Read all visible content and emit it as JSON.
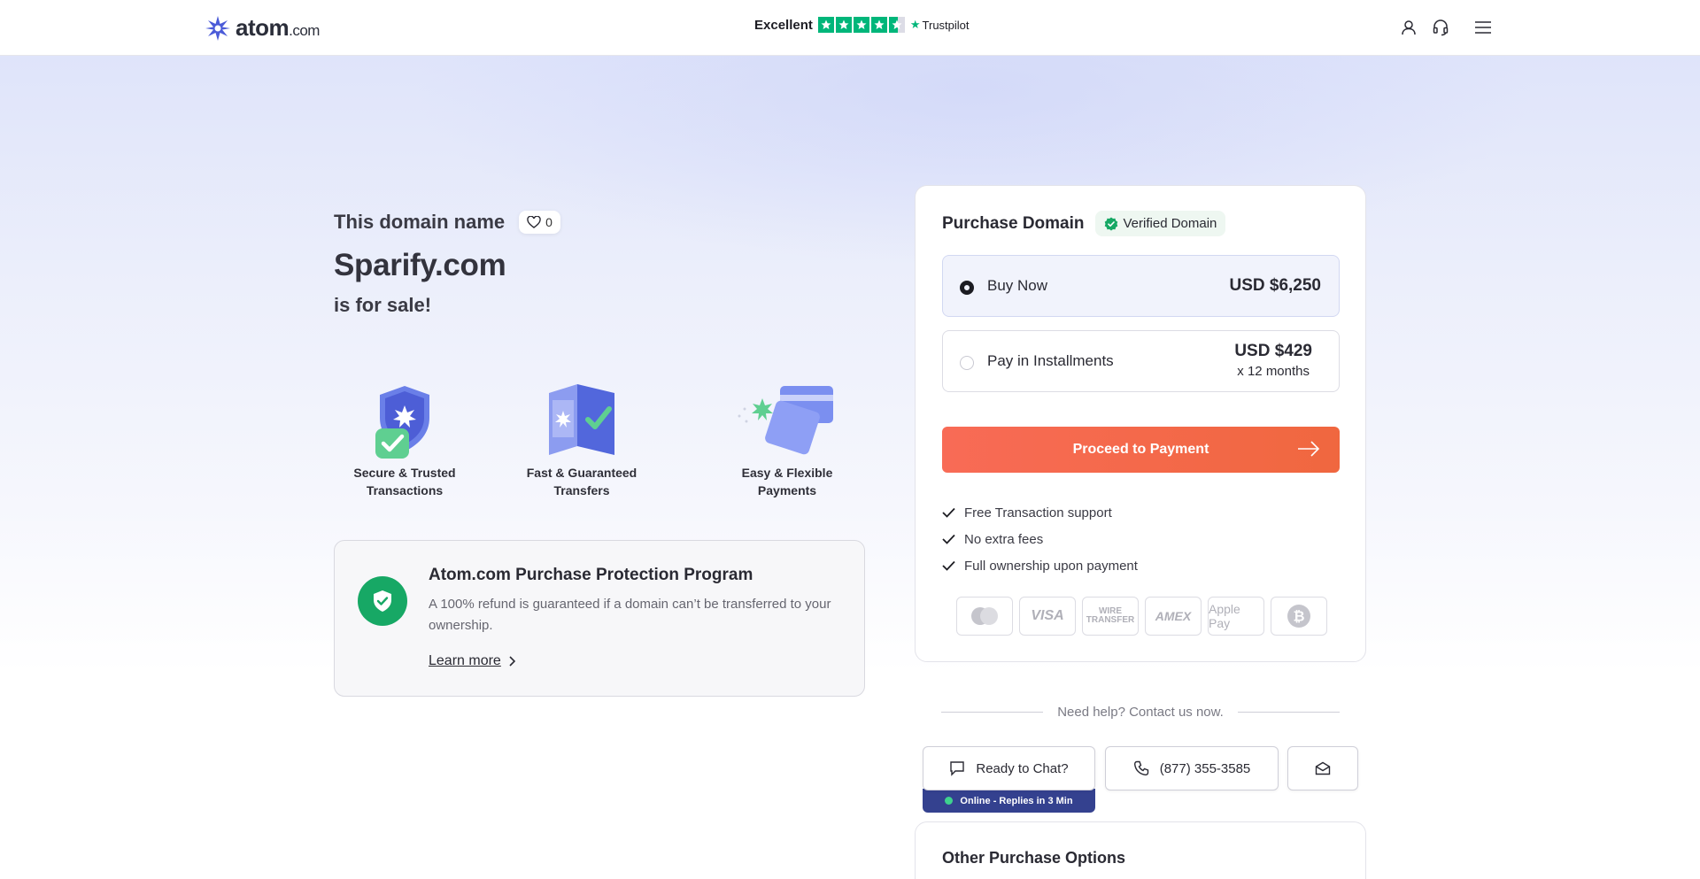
{
  "header": {
    "logo_main": "atom",
    "logo_suffix": ".com",
    "trust_label": "Excellent",
    "trust_brand": "Trustpilot",
    "rating_stars": 4.5,
    "icons": [
      "user-icon",
      "headset-icon",
      "menu-icon"
    ]
  },
  "hero": {
    "lead": "This domain name",
    "likes": "0",
    "domain": "Sparify.com",
    "tagline": "is for sale!"
  },
  "features": [
    {
      "label_line1": "Secure & Trusted",
      "label_line2": "Transactions",
      "icon": "shield-check-icon"
    },
    {
      "label_line1": "Fast & Guaranteed",
      "label_line2": "Transfers",
      "icon": "transfer-icon"
    },
    {
      "label_line1": "Easy & Flexible",
      "label_line2": "Payments",
      "icon": "cards-icon"
    }
  ],
  "protection": {
    "title": "Atom.com Purchase Protection Program",
    "description": "A 100% refund is guaranteed if a domain can’t be transferred to your ownership.",
    "link": "Learn more"
  },
  "purchase": {
    "title": "Purchase Domain",
    "badge": "Verified Domain",
    "options": [
      {
        "label": "Buy Now",
        "price": "USD $6,250",
        "selected": true
      },
      {
        "label": "Pay in Installments",
        "price": "USD $429",
        "term": "x 12 months",
        "selected": false
      }
    ],
    "cta": "Proceed to Payment",
    "perks": [
      "Free Transaction support",
      "No extra fees",
      "Full ownership upon payment"
    ],
    "payment_methods": [
      "Mastercard",
      "VISA",
      "WIRE TRANSFER",
      "AMEX",
      "Apple Pay",
      "Bitcoin"
    ]
  },
  "help": {
    "text": "Need help? Contact us now.",
    "chat": "Ready to Chat?",
    "online": "Online - Replies in 3 Min",
    "phone": "(877) 355-3585"
  },
  "other": {
    "title": "Other Purchase Options"
  },
  "colors": {
    "accent": "#f86b56",
    "trustpilot": "#00b67a",
    "verified": "#17a865",
    "brand": "#4b5bd8"
  }
}
